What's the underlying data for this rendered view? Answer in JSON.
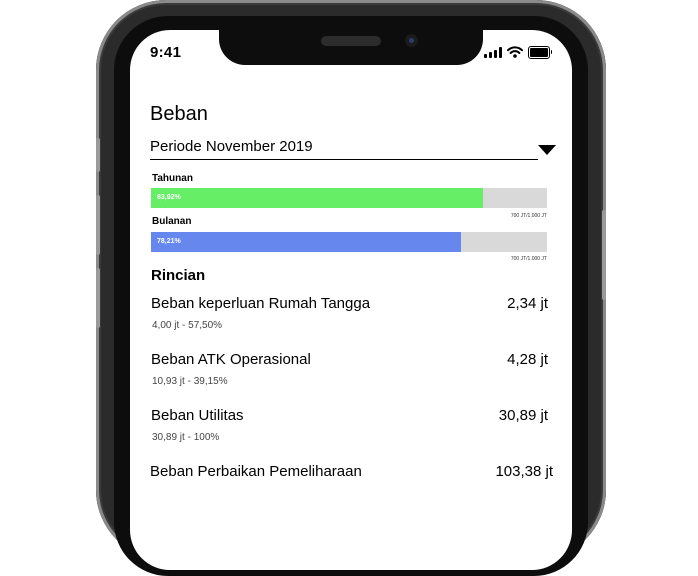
{
  "status": {
    "time": "9:41"
  },
  "page": {
    "title": "Beban"
  },
  "period": {
    "label": "Periode November 2019"
  },
  "bars": [
    {
      "label": "Tahunan",
      "percent_text": "83,92%",
      "fraction": 0.8392,
      "caption": "700 JT/1.000 JT",
      "color": "#66ee66"
    },
    {
      "label": "Bulanan",
      "percent_text": "78,21%",
      "fraction": 0.7821,
      "caption": "700 JT/1.000 JT",
      "color": "#6688ee"
    }
  ],
  "details": {
    "title": "Rincian",
    "items": [
      {
        "name": "Beban keperluan Rumah Tangga",
        "amount": "2,34 jt",
        "sub": "4,00 jt - 57,50%"
      },
      {
        "name": "Beban ATK Operasional",
        "amount": "4,28 jt",
        "sub": "10,93 jt - 39,15%"
      },
      {
        "name": "Beban Utilitas",
        "amount": "30,89 jt",
        "sub": "30,89 jt - 100%"
      },
      {
        "name": "Beban Perbaikan Pemeliharaan",
        "amount": "103,38 jt",
        "sub": ""
      }
    ]
  },
  "icons": [
    "cellular-signal-icon",
    "wifi-icon",
    "battery-icon",
    "dropdown-arrow-icon"
  ]
}
